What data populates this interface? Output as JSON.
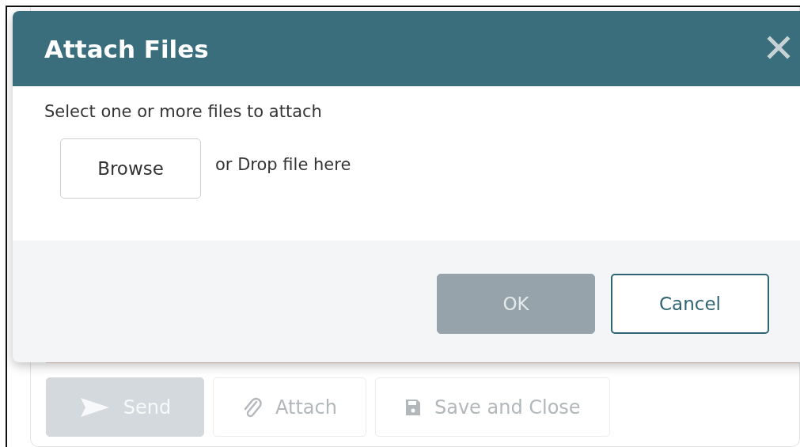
{
  "dialog": {
    "title": "Attach Files",
    "instruction": "Select one or more files to attach",
    "browse_button": "Browse",
    "drop_hint": "or Drop file here",
    "buttons": [
      {
        "label": "OK",
        "kind": "primary",
        "disabled": true
      },
      {
        "label": "Cancel",
        "kind": "secondary",
        "disabled": false
      }
    ]
  },
  "toolbar": [
    {
      "label": "Send",
      "disabled": true
    },
    {
      "label": "Attach",
      "disabled": false
    },
    {
      "label": "Save and Close",
      "disabled": false
    }
  ]
}
